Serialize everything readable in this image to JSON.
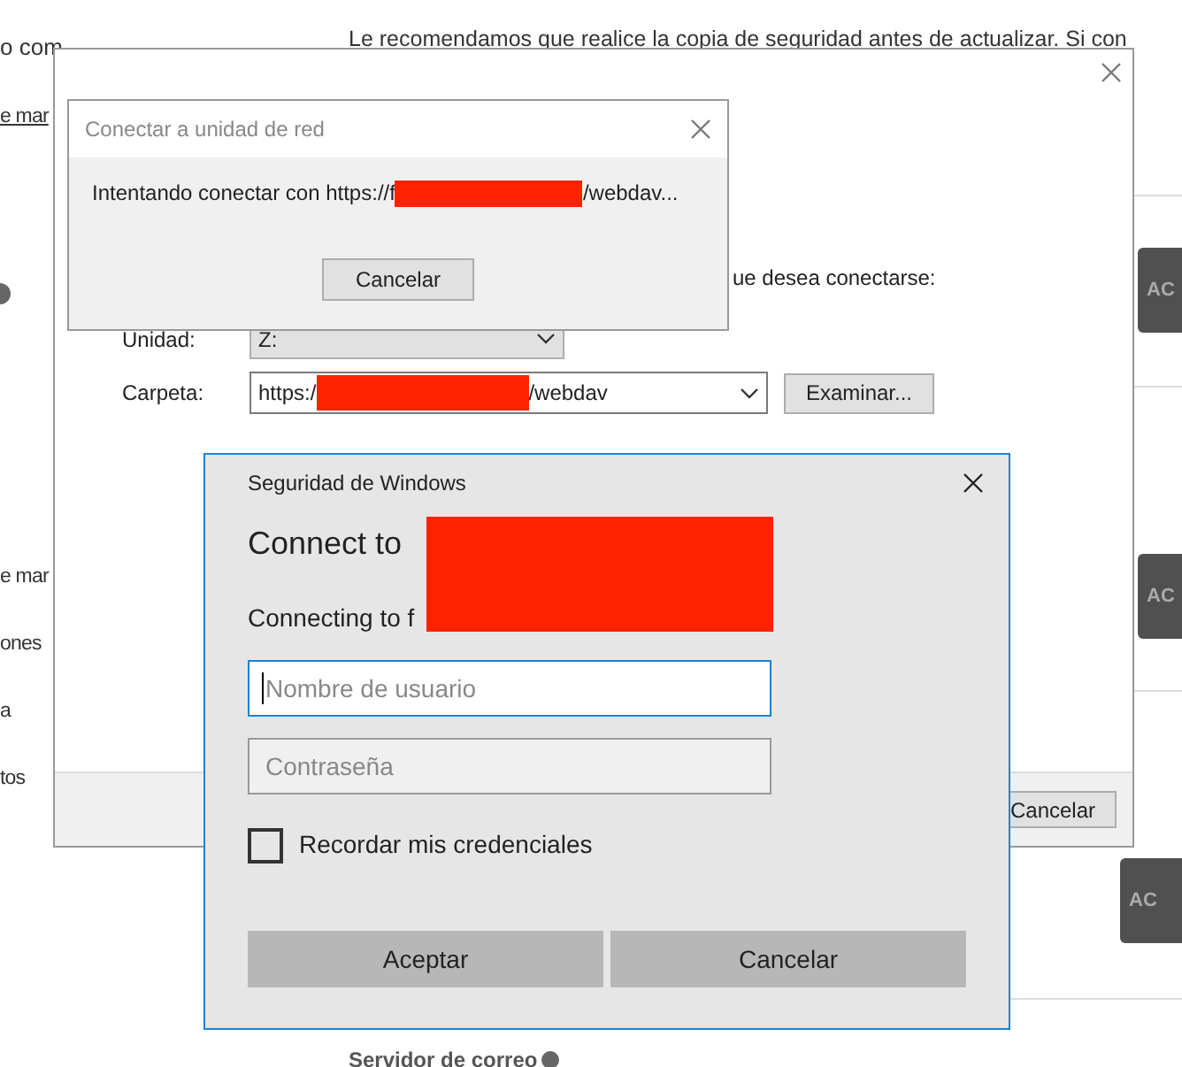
{
  "background_page": {
    "top_left_text": "o com",
    "intro": "Le recomendamos que realice la copia de seguridad antes de actualizar. Si con",
    "side_link": "e mar",
    "side_items": [
      "e mar",
      "ones",
      "a",
      "tos"
    ],
    "action_buttons": [
      "AC",
      "AC",
      "AC"
    ],
    "footer_label": "Servidor de correo"
  },
  "map_drive_dialog": {
    "instruction": "ue desea conectarse:",
    "drive_label": "Unidad:",
    "drive_value": "Z:",
    "folder_label": "Carpeta:",
    "folder_prefix": "https:/",
    "folder_suffix": "/webdav",
    "browse_button": "Examinar...",
    "footer_button": "Cancelar"
  },
  "progress_dialog": {
    "title": "Conectar a unidad de red",
    "message_prefix": "Intentando conectar con https://f",
    "message_suffix": "/webdav...",
    "button": "Cancelar"
  },
  "security_dialog": {
    "title": "Seguridad de Windows",
    "heading": "Connect to",
    "subheading": "Connecting to f",
    "username": {
      "placeholder": "Nombre de usuario",
      "focused": true
    },
    "password": {
      "placeholder": "Contraseña"
    },
    "remember": {
      "label": "Recordar mis credenciales",
      "checked": false
    },
    "buttons": [
      "Aceptar",
      "Cancelar"
    ]
  }
}
